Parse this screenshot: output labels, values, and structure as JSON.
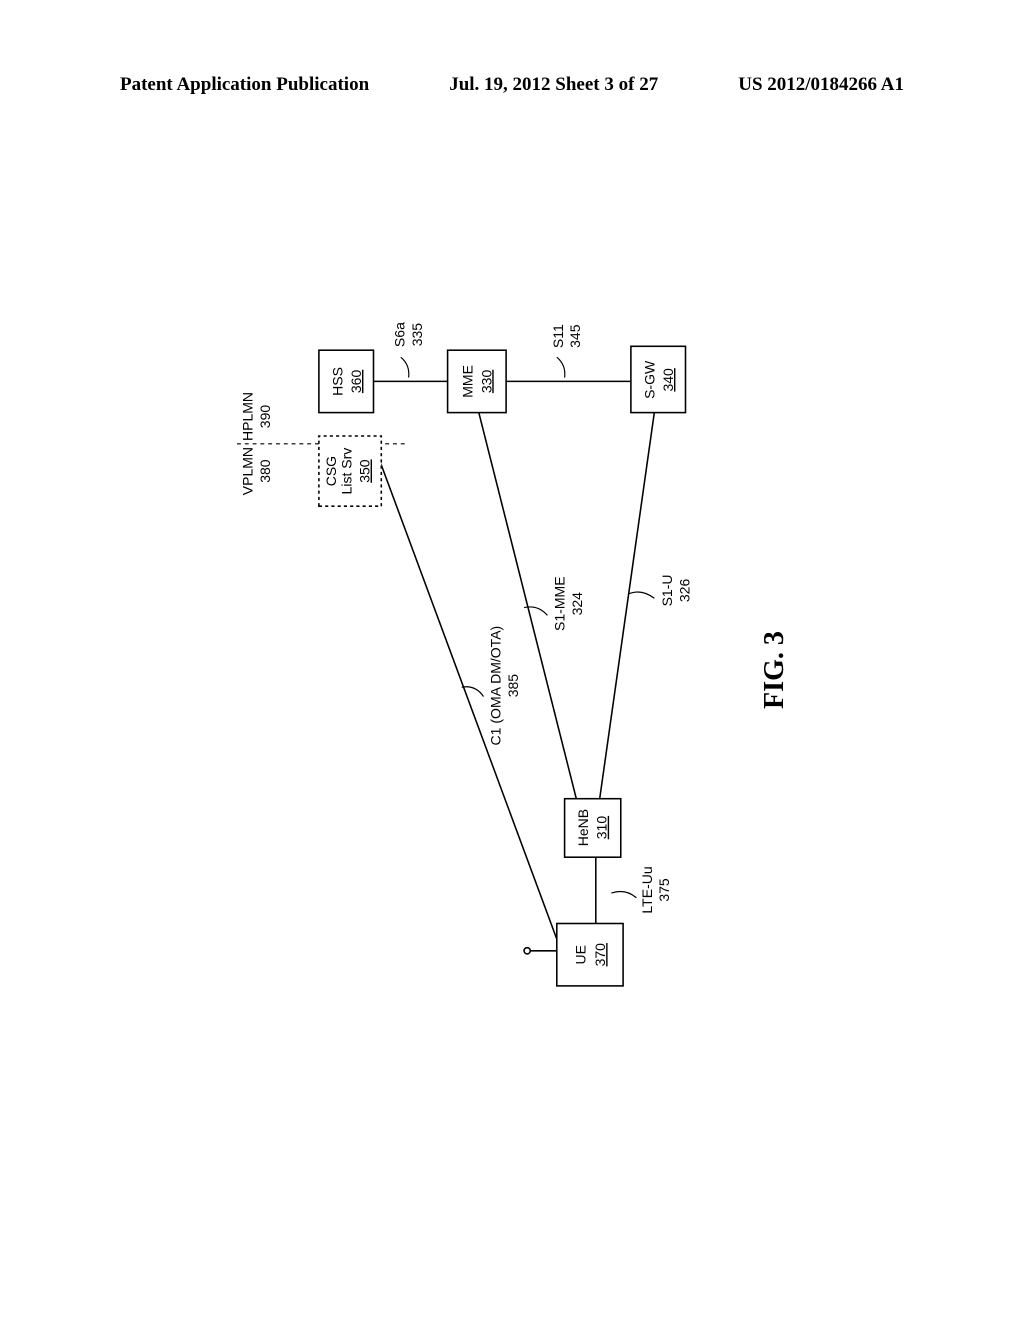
{
  "header": {
    "left": "Patent Application Publication",
    "center": "Jul. 19, 2012  Sheet 3 of 27",
    "right": "US 2012/0184266 A1"
  },
  "figure_caption": "FIG. 3",
  "nodes": {
    "ue": {
      "label": "UE",
      "num": "370"
    },
    "henb": {
      "label": "HeNB",
      "num": "310"
    },
    "mme": {
      "label": "MME",
      "num": "330"
    },
    "sgw": {
      "label": "S-GW",
      "num": "340"
    },
    "hss": {
      "label": "HSS",
      "num": "360"
    },
    "csg": {
      "label1": "CSG",
      "label2": "List Srv",
      "num": "350"
    }
  },
  "regions": {
    "vplmn": {
      "label": "VPLMN",
      "num": "380"
    },
    "hplmn": {
      "label": "HPLMN",
      "num": "390"
    }
  },
  "edges": {
    "lte_uu": {
      "label": "LTE-Uu",
      "num": "375"
    },
    "c1": {
      "label": "C1 (OMA DM/OTA)",
      "num": "385"
    },
    "s1_mme": {
      "label": "S1-MME",
      "num": "324"
    },
    "s1_u": {
      "label": "S1-U",
      "num": "326"
    },
    "s6a": {
      "label": "S6a",
      "num": "335"
    },
    "s11": {
      "label": "S11",
      "num": "345"
    }
  }
}
